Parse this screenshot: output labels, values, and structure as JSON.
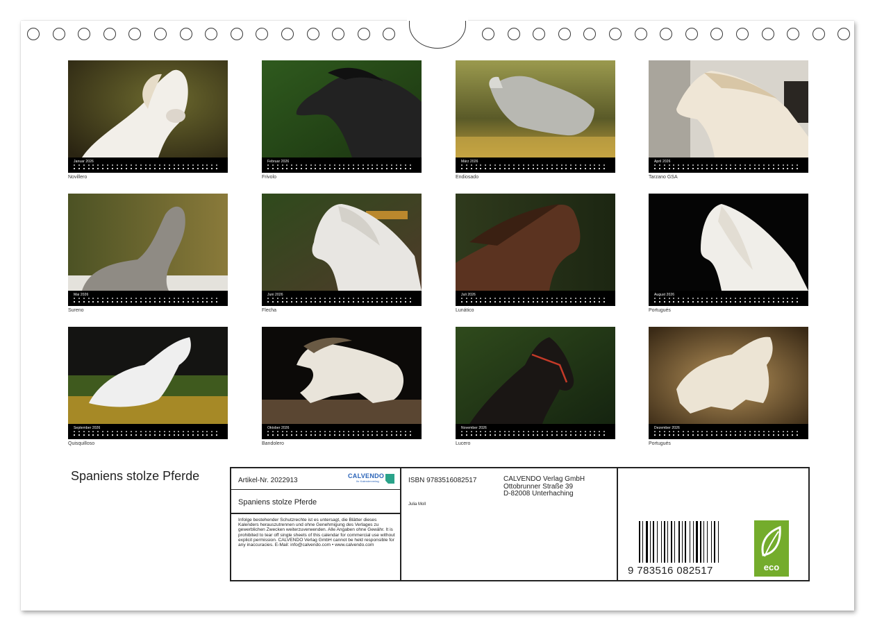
{
  "calendar": {
    "title": "Spaniens stolze Pferde",
    "months": [
      {
        "month": "Januar 2026",
        "caption": "Novillero"
      },
      {
        "month": "Februar 2026",
        "caption": "Frivolo"
      },
      {
        "month": "März 2026",
        "caption": "Endiosado"
      },
      {
        "month": "April 2026",
        "caption": "Tarzano GSA"
      },
      {
        "month": "Mai 2026",
        "caption": "Sureno"
      },
      {
        "month": "Juni 2026",
        "caption": "Flecha"
      },
      {
        "month": "Juli 2026",
        "caption": "Lunático"
      },
      {
        "month": "August 2026",
        "caption": "Portugués"
      },
      {
        "month": "September 2026",
        "caption": "Quisquilloso"
      },
      {
        "month": "Oktober 2026",
        "caption": "Bandolero"
      },
      {
        "month": "November 2026",
        "caption": "Lucero"
      },
      {
        "month": "Dezember 2026",
        "caption": "Portugués"
      }
    ]
  },
  "info": {
    "article": "Artikel-Nr. 2022913",
    "logo_word": "CALVENDO",
    "logo_sub": "Ihr Kalenderverlag",
    "name": "Spaniens stolze Pferde",
    "legal": "Infolge bestehender Schutzrechte ist es untersagt, die Blätter dieses Kalenders herauszutrennen und ohne Genehmigung des Verlages zu gewerblichen Zwecken weiterzuverwenden. Alle Angaben ohne Gewähr. It is prohibited to tear off single sheets of this calendar for commercial use without explicit permission. CALVENDO Verlag GmbH cannot be held responsible for any inaccuracies. E-Mail: info@calvendo.com • www.calvendo.com",
    "isbn": "ISBN 9783516082517",
    "author": "Julia Moll",
    "publisher_line1": "CALVENDO Verlag GmbH",
    "publisher_line2": "Ottobrunner Straße 39",
    "publisher_line3": "D-82008 Unterhaching",
    "barcode_digits": "9 783516 082517",
    "eco_label": "eco"
  },
  "colors": {
    "calendar_bar": "#000000",
    "eco_green": "#74ac2c",
    "calvendo_blue": "#2b64b8"
  }
}
